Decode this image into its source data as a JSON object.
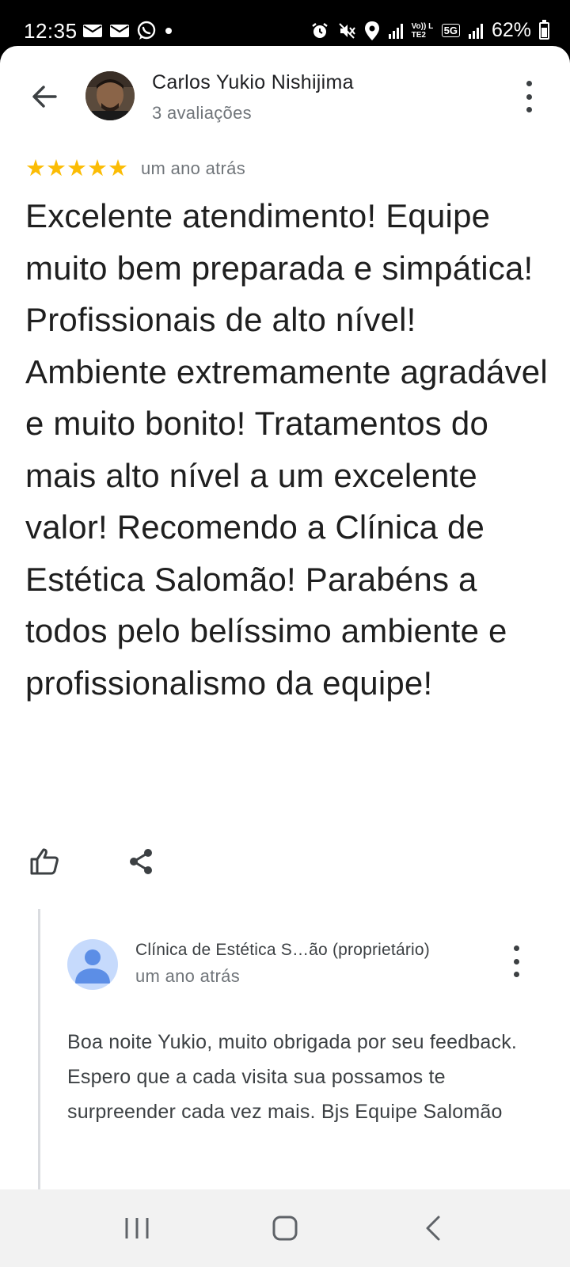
{
  "status_bar": {
    "time": "12:35",
    "battery": "62%",
    "battery_level": 0.62,
    "left_icons": [
      "email-icon",
      "email-icon",
      "whatsapp-icon",
      "dot-icon"
    ],
    "right_icons": [
      "alarm-icon",
      "mute-icon",
      "location-icon",
      "signal-icon",
      "volte-icon",
      "5g-icon",
      "signal-icon",
      "battery-icon"
    ],
    "volte_label": "Vo)) LTE2",
    "network_label": "5G"
  },
  "header": {
    "reviewer_name": "Carlos Yukio Nishijima",
    "reviewer_meta": "3 avaliações"
  },
  "review": {
    "stars": 5,
    "star_glyphs": "★★★★★",
    "date": "um ano atrás",
    "text": "Excelente atendimento! Equipe muito bem preparada e simpática! Profissionais de alto nível! Ambiente extremamente agradável e muito bonito! Tratamentos do mais alto nível a um excelente valor! Recomendo a Clínica de Estética Salomão! Parabéns a todos pelo belíssimo ambiente e profissionalismo da equipe!"
  },
  "owner_reply": {
    "name": "Clínica de Estética S…ão (proprietário)",
    "date": "um ano atrás",
    "text": "Boa noite Yukio, muito obrigada por seu feedback.  Espero que a cada visita sua possamos te surpreender cada vez mais.  Bjs Equipe Salomão"
  },
  "colors": {
    "star": "#fbbc04",
    "owner_avatar_bg": "#c6dafc",
    "owner_avatar_fg": "#5c8ee6",
    "text_primary": "#1f1f1f",
    "text_secondary": "#70757a"
  },
  "nav_bar": {
    "buttons": [
      "recent-apps-icon",
      "home-icon",
      "back-icon"
    ]
  }
}
